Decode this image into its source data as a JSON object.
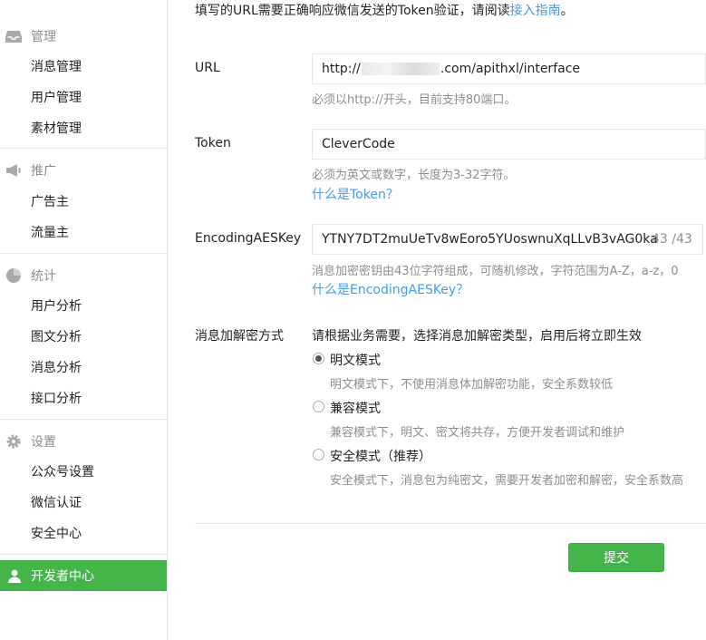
{
  "sidebar": {
    "sections": [
      {
        "icon": "inbox-icon",
        "title": "管理",
        "items": [
          "消息管理",
          "用户管理",
          "素材管理"
        ]
      },
      {
        "icon": "megaphone-icon",
        "title": "推广",
        "items": [
          "广告主",
          "流量主"
        ]
      },
      {
        "icon": "pie-chart-icon",
        "title": "统计",
        "items": [
          "用户分析",
          "图文分析",
          "消息分析",
          "接口分析"
        ]
      },
      {
        "icon": "gear-icon",
        "title": "设置",
        "items": [
          "公众号设置",
          "微信认证",
          "安全中心"
        ]
      }
    ],
    "active": {
      "icon": "user-icon",
      "label": "开发者中心"
    },
    "active_color": "#44b549"
  },
  "main": {
    "top_note": {
      "text": "填写的URL需要正确响应微信发送的Token验证，请阅读",
      "link": "接入指南",
      "end": "。"
    },
    "url": {
      "label": "URL",
      "value_prefix": "http://",
      "value_suffix": ".com/apithxl/interface",
      "hint": "必须以http://开头，目前支持80端口。"
    },
    "token": {
      "label": "Token",
      "value": "CleverCode",
      "hint": "必须为英文或数字，长度为3-32字符。",
      "link": "什么是Token？"
    },
    "aes": {
      "label": "EncodingAESKey",
      "value": "YTNY7DT2muUeTv8wEoro5YUoswnuXqLLvB3vAG0ka",
      "counter": "43 /43",
      "hint": "消息加密密钥由43位字符组成，可随机修改，字符范围为A-Z，a-z，0",
      "link": "什么是EncodingAESKey？"
    },
    "encrypt": {
      "label": "消息加解密方式",
      "intro": "请根据业务需要，选择消息加解密类型，启用后将立即生效",
      "options": [
        {
          "label": "明文模式",
          "desc": "明文模式下，不使用消息体加解密功能，安全系数较低",
          "checked": true
        },
        {
          "label": "兼容模式",
          "desc": "兼容模式下，明文、密文将共存，方便开发者调试和维护",
          "checked": false
        },
        {
          "label": "安全模式（推荐）",
          "desc": "安全模式下，消息包为纯密文，需要开发者加密和解密，安全系数高",
          "checked": false
        }
      ]
    },
    "submit_label": "提交",
    "link_color": "#459ae9"
  }
}
